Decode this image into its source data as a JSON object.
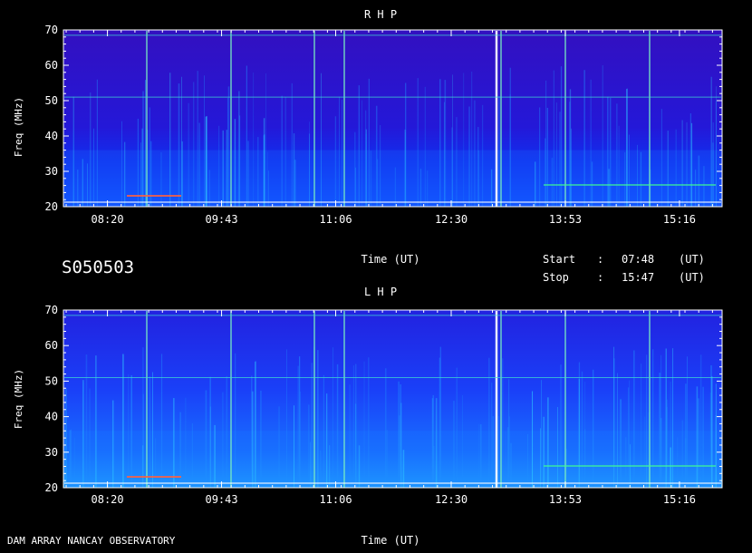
{
  "observation_id": "S050503",
  "footer_label": "DAM ARRAY  NANCAY OBSERVATORY",
  "start": {
    "label": "Start",
    "sep": ":",
    "value": "07:48",
    "unit": "(UT)"
  },
  "stop": {
    "label": "Stop",
    "sep": ":",
    "value": "15:47",
    "unit": "(UT)"
  },
  "colors": {
    "background": "#000000",
    "low": "#2a10c8",
    "mid": "#1a60ff",
    "high": "#20ffd0",
    "burst": "#ffffff"
  },
  "chart_data": [
    {
      "type": "heatmap",
      "title": "R H P",
      "xlabel": "Time (UT)",
      "ylabel": "Freq (MHz)",
      "x_ticks": [
        "08:20",
        "09:43",
        "11:06",
        "12:30",
        "13:53",
        "15:16"
      ],
      "y_ticks": [
        20,
        30,
        40,
        50,
        60,
        70
      ],
      "ylim": [
        20,
        70
      ],
      "xlim": [
        "07:48",
        "15:47"
      ]
    },
    {
      "type": "heatmap",
      "title": "L H P",
      "xlabel": "Time (UT)",
      "ylabel": "Freq (MHz)",
      "x_ticks": [
        "08:20",
        "09:43",
        "11:06",
        "12:30",
        "13:53",
        "15:16"
      ],
      "y_ticks": [
        20,
        30,
        40,
        50,
        60,
        70
      ],
      "ylim": [
        20,
        70
      ],
      "xlim": [
        "07:48",
        "15:47"
      ]
    }
  ]
}
